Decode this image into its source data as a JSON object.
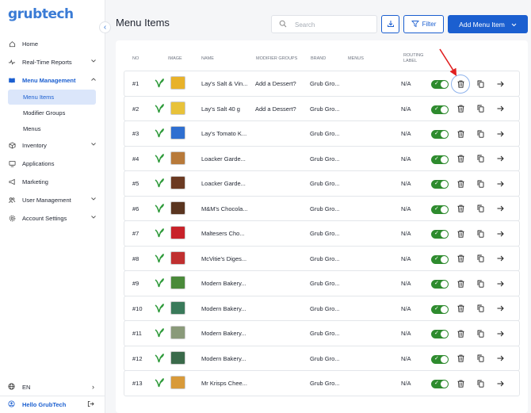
{
  "app": {
    "logo": "grubtech"
  },
  "sidebar": {
    "items": [
      {
        "label": "Home",
        "icon": "home-icon",
        "chevron": false
      },
      {
        "label": "Real-Time Reports",
        "icon": "pulse-icon",
        "chevron": true
      },
      {
        "label": "Menu Management",
        "icon": "book-icon",
        "chevron": true,
        "expanded": true
      }
    ],
    "sub_items": [
      {
        "label": "Menu Items",
        "selected": true
      },
      {
        "label": "Modifier Groups",
        "selected": false
      },
      {
        "label": "Menus",
        "selected": false
      }
    ],
    "items_after": [
      {
        "label": "Inventory",
        "icon": "box-icon",
        "chevron": true
      },
      {
        "label": "Applications",
        "icon": "monitor-icon",
        "chevron": false
      },
      {
        "label": "Marketing",
        "icon": "megaphone-icon",
        "chevron": false
      },
      {
        "label": "User Management",
        "icon": "users-icon",
        "chevron": true
      },
      {
        "label": "Account Settings",
        "icon": "gear-icon",
        "chevron": true
      }
    ],
    "language": "EN",
    "user": "Hello GrubTech"
  },
  "header": {
    "title": "Menu Items",
    "search_placeholder": "Search",
    "filter_label": "Filter",
    "add_label": "Add Menu Item"
  },
  "table": {
    "columns": {
      "no": "NO",
      "image": "IMAGE",
      "name": "NAME",
      "modifier_groups": "MODIFIER GROUPS",
      "brand": "BRAND",
      "menus": "MENUS",
      "routing_1": "ROUTING",
      "routing_2": "LABEL"
    },
    "rows": [
      {
        "no": "#1",
        "name": "Lay's Salt & Vin...",
        "modifier": "Add a Dessert?",
        "brand": "Grub Gro...",
        "routing": "N/A",
        "img": "#e8b22a"
      },
      {
        "no": "#2",
        "name": "Lay's Salt 40 g",
        "modifier": "Add a Dessert?",
        "brand": "Grub Gro...",
        "routing": "N/A",
        "img": "#e8c23a"
      },
      {
        "no": "#3",
        "name": "Lay's Tomato K...",
        "modifier": "",
        "brand": "Grub Gro...",
        "routing": "N/A",
        "img": "#2f6fd0"
      },
      {
        "no": "#4",
        "name": "Loacker Garde...",
        "modifier": "",
        "brand": "Grub Gro...",
        "routing": "N/A",
        "img": "#b87a3a"
      },
      {
        "no": "#5",
        "name": "Loacker Garde...",
        "modifier": "",
        "brand": "Grub Gro...",
        "routing": "N/A",
        "img": "#6b3a22"
      },
      {
        "no": "#6",
        "name": "M&M's Chocola...",
        "modifier": "",
        "brand": "Grub Gro...",
        "routing": "N/A",
        "img": "#5a3520"
      },
      {
        "no": "#7",
        "name": "Maltesers Cho...",
        "modifier": "",
        "brand": "Grub Gro...",
        "routing": "N/A",
        "img": "#c8222a"
      },
      {
        "no": "#8",
        "name": "McVitie's Diges...",
        "modifier": "",
        "brand": "Grub Gro...",
        "routing": "N/A",
        "img": "#c03030"
      },
      {
        "no": "#9",
        "name": "Modern Bakery...",
        "modifier": "",
        "brand": "Grub Gro...",
        "routing": "N/A",
        "img": "#4a8a3a"
      },
      {
        "no": "#10",
        "name": "Modern Bakery...",
        "modifier": "",
        "brand": "Grub Gro...",
        "routing": "N/A",
        "img": "#3a7a5a"
      },
      {
        "no": "#11",
        "name": "Modern Bakery...",
        "modifier": "",
        "brand": "Grub Gro...",
        "routing": "N/A",
        "img": "#8a9a7a"
      },
      {
        "no": "#12",
        "name": "Modern Bakery...",
        "modifier": "",
        "brand": "Grub Gro...",
        "routing": "N/A",
        "img": "#3a6a4a"
      },
      {
        "no": "#13",
        "name": "Mr Krisps Chee...",
        "modifier": "",
        "brand": "Grub Gro...",
        "routing": "N/A",
        "img": "#d89a3a"
      }
    ]
  },
  "colors": {
    "primary": "#1b5fd0",
    "toggle_on": "#2e8b2e",
    "veg_leaf": "#2e9a3a",
    "annotation_arrow": "#e02020"
  }
}
